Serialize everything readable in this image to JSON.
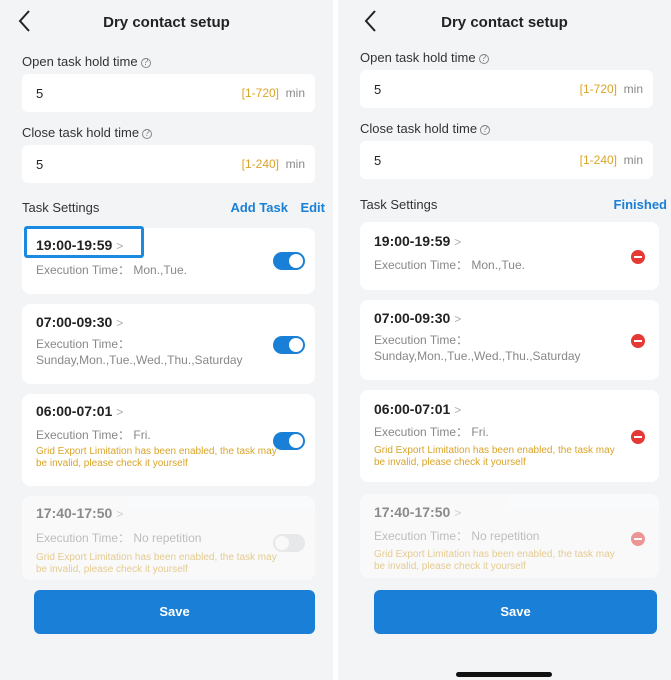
{
  "left": {
    "title": "Dry contact setup",
    "open_label": "Open task hold time",
    "open_value": "5",
    "open_range": "[1-720]",
    "open_unit": "min",
    "close_label": "Close task hold time",
    "close_value": "5",
    "close_range": "[1-240]",
    "close_unit": "min",
    "task_settings": "Task Settings",
    "add_task": "Add Task",
    "edit": "Edit",
    "tasks": [
      {
        "time": "19:00-19:59",
        "exec": "Execution Time： Mon.,Tue.",
        "enabled": true
      },
      {
        "time": "07:00-09:30",
        "exec_label": "Execution Time：",
        "exec_days": "Sunday,Mon.,Tue.,Wed.,Thu.,Saturday",
        "enabled": true
      },
      {
        "time": "06:00-07:01",
        "exec": "Execution Time： Fri.",
        "warning_1": "Grid Export Limitation has been enabled, the task may",
        "warning_2": "be invalid, please check it yourself",
        "enabled": true
      },
      {
        "time": "17:40-17:50",
        "exec": "Execution Time： No repetition",
        "warning_1": "Grid Export Limitation has been enabled, the task may",
        "warning_2": "be invalid, please check it yourself",
        "enabled": false
      }
    ],
    "save": "Save"
  },
  "right": {
    "title": "Dry contact setup",
    "open_label": "Open task hold time",
    "open_value": "5",
    "open_range": "[1-720]",
    "open_unit": "min",
    "close_label": "Close task hold time",
    "close_value": "5",
    "close_range": "[1-240]",
    "close_unit": "min",
    "task_settings": "Task Settings",
    "finished": "Finished",
    "tasks": [
      {
        "time": "19:00-19:59",
        "exec": "Execution Time： Mon.,Tue."
      },
      {
        "time": "07:00-09:30",
        "exec_label": "Execution Time：",
        "exec_days": "Sunday,Mon.,Tue.,Wed.,Thu.,Saturday"
      },
      {
        "time": "06:00-07:01",
        "exec": "Execution Time： Fri.",
        "warning_1": "Grid Export Limitation has been enabled, the task may",
        "warning_2": "be invalid, please check it yourself"
      },
      {
        "time": "17:40-17:50",
        "exec": "Execution Time： No repetition",
        "warning_1": "Grid Export Limitation has been enabled, the task may",
        "warning_2": "be invalid, please check it yourself"
      }
    ],
    "save": "Save"
  },
  "icons": {
    "back": "chevron-left-icon",
    "help": "help-circle-icon",
    "chevron": "chevron-right-icon",
    "delete": "minus-circle-icon"
  },
  "colors": {
    "accent": "#1a7fd6",
    "warning": "#d9a429",
    "delete": "#e53935",
    "highlight": "#1a8be0"
  }
}
